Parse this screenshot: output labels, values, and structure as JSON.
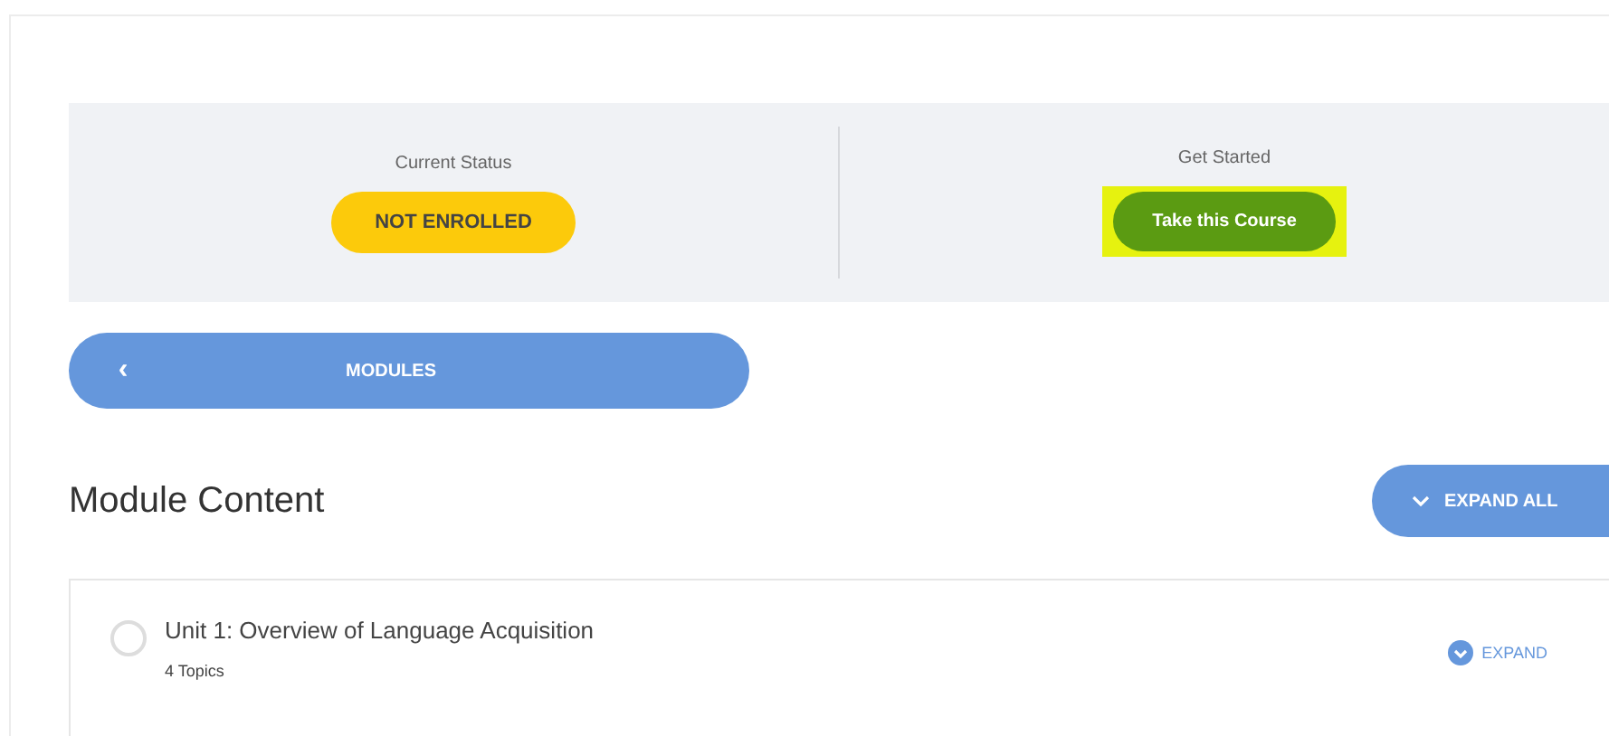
{
  "status_panel": {
    "current_status": {
      "label": "Current Status",
      "badge": "NOT ENROLLED"
    },
    "get_started": {
      "label": "Get Started",
      "button": "Take this Course",
      "highlighted": true
    }
  },
  "modules_bar": {
    "back_icon": "‹",
    "label": "MODULES"
  },
  "module_content": {
    "title": "Module Content",
    "expand_all": "EXPAND ALL",
    "units": [
      {
        "title": "Unit 1: Overview of Language Acquisition",
        "topics": "4 Topics",
        "completed": false,
        "action": "EXPAND"
      }
    ]
  }
}
